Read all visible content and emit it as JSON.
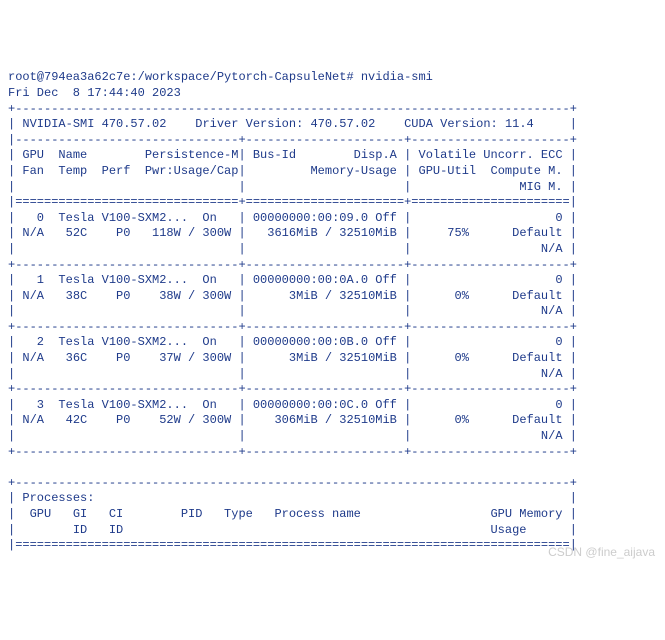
{
  "prompt_line": "root@794ea3a62c7e:/workspace/Pytorch-CapsuleNet# nvidia-smi",
  "timestamp": "Fri Dec  8 17:44:40 2023",
  "header": {
    "smi_version": "NVIDIA-SMI 470.57.02",
    "driver_label": "Driver Version:",
    "driver_version": "470.57.02",
    "cuda_label": "CUDA Version:",
    "cuda_version": "11.4"
  },
  "col_labels": {
    "r1c1": " GPU  Name        Persistence-M",
    "r1c2": " Bus-Id        Disp.A ",
    "r1c3": " Volatile Uncorr. ECC ",
    "r2c1": " Fan  Temp  Perf  Pwr:Usage/Cap",
    "r2c2": "         Memory-Usage ",
    "r2c3": " GPU-Util  Compute M. ",
    "r3c1": "                               ",
    "r3c2": "                      ",
    "r3c3": "               MIG M. "
  },
  "gpus": [
    {
      "r1c1": "   0  Tesla V100-SXM2...  On   ",
      "r1c2": " 00000000:00:09.0 Off ",
      "r1c3": "                    0 ",
      "r2c1": " N/A   52C    P0   118W / 300W ",
      "r2c2": "   3616MiB / 32510MiB ",
      "r2c3": "     75%      Default ",
      "r3c1": "                               ",
      "r3c2": "                      ",
      "r3c3": "                  N/A "
    },
    {
      "r1c1": "   1  Tesla V100-SXM2...  On   ",
      "r1c2": " 00000000:00:0A.0 Off ",
      "r1c3": "                    0 ",
      "r2c1": " N/A   38C    P0    38W / 300W ",
      "r2c2": "      3MiB / 32510MiB ",
      "r2c3": "      0%      Default ",
      "r3c1": "                               ",
      "r3c2": "                      ",
      "r3c3": "                  N/A "
    },
    {
      "r1c1": "   2  Tesla V100-SXM2...  On   ",
      "r1c2": " 00000000:00:0B.0 Off ",
      "r1c3": "                    0 ",
      "r2c1": " N/A   36C    P0    37W / 300W ",
      "r2c2": "      3MiB / 32510MiB ",
      "r2c3": "      0%      Default ",
      "r3c1": "                               ",
      "r3c2": "                      ",
      "r3c3": "                  N/A "
    },
    {
      "r1c1": "   3  Tesla V100-SXM2...  On   ",
      "r1c2": " 00000000:00:0C.0 Off ",
      "r1c3": "                    0 ",
      "r2c1": " N/A   42C    P0    52W / 300W ",
      "r2c2": "    306MiB / 32510MiB ",
      "r2c3": "      0%      Default ",
      "r3c1": "                               ",
      "r3c2": "                      ",
      "r3c3": "                  N/A "
    }
  ],
  "processes": {
    "title": " Processes:                                                                  ",
    "h1": "  GPU   GI   CI        PID   Type   Process name                  GPU Memory ",
    "h2": "        ID   ID                                                   Usage      "
  },
  "watermark": "CSDN @fine_aijava"
}
